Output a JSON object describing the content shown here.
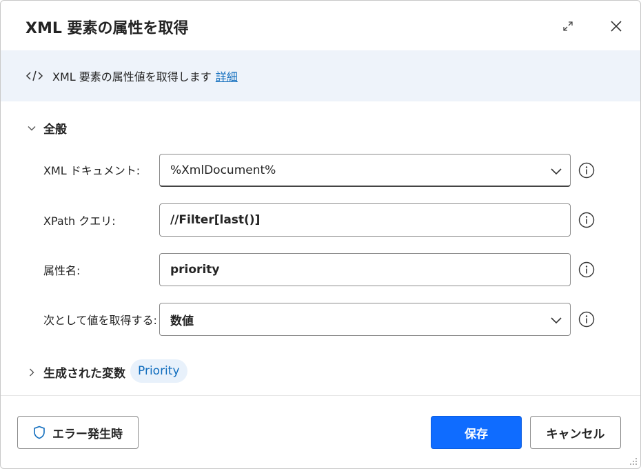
{
  "dialog": {
    "title": "XML 要素の属性を取得",
    "expand_icon": "expand-icon",
    "close_icon": "close-icon"
  },
  "banner": {
    "icon": "code-icon",
    "text": "XML 要素の属性値を取得します",
    "link": "詳細"
  },
  "general": {
    "header": "全般",
    "fields": [
      {
        "label": "XML ドキュメント:",
        "value": "%XmlDocument%",
        "kind": "combo"
      },
      {
        "label": "XPath クエリ:",
        "value": "//Filter[last()]",
        "kind": "text"
      },
      {
        "label": "属性名:",
        "value": "priority",
        "kind": "text"
      },
      {
        "label": "次として値を取得する:",
        "value": "数値",
        "kind": "select"
      }
    ]
  },
  "variables": {
    "header": "生成された変数",
    "items": [
      "Priority"
    ]
  },
  "footer": {
    "error_button": "エラー発生時",
    "save_button": "保存",
    "cancel_button": "キャンセル"
  },
  "colors": {
    "accent": "#0f6cff",
    "link": "#0f6cbd",
    "banner_bg": "#eef3fa",
    "pill_bg": "#e8f1fb"
  }
}
